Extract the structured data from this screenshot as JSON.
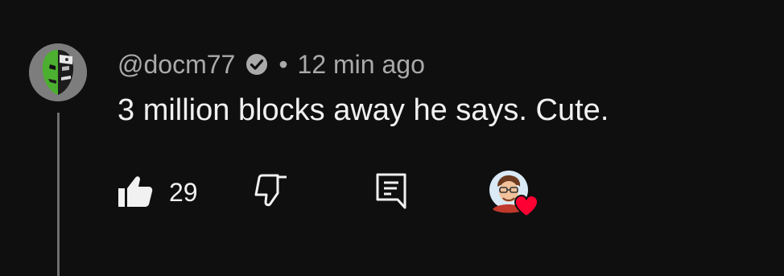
{
  "comment": {
    "username": "@docm77",
    "separator": "•",
    "timestamp": "12 min ago",
    "text": "3 million blocks away he says. Cute.",
    "likes": "29",
    "verified": true
  },
  "icons": {
    "verified": "verified-check-icon",
    "like": "thumbs-up-icon",
    "dislike": "thumbs-down-icon",
    "reply": "reply-comment-icon",
    "creator_heart": "creator-heart-icon"
  },
  "colors": {
    "background": "#0f0f0f",
    "primary_text": "#f1f1f1",
    "secondary_text": "#aaaaaa",
    "heart": "#ff0033"
  }
}
